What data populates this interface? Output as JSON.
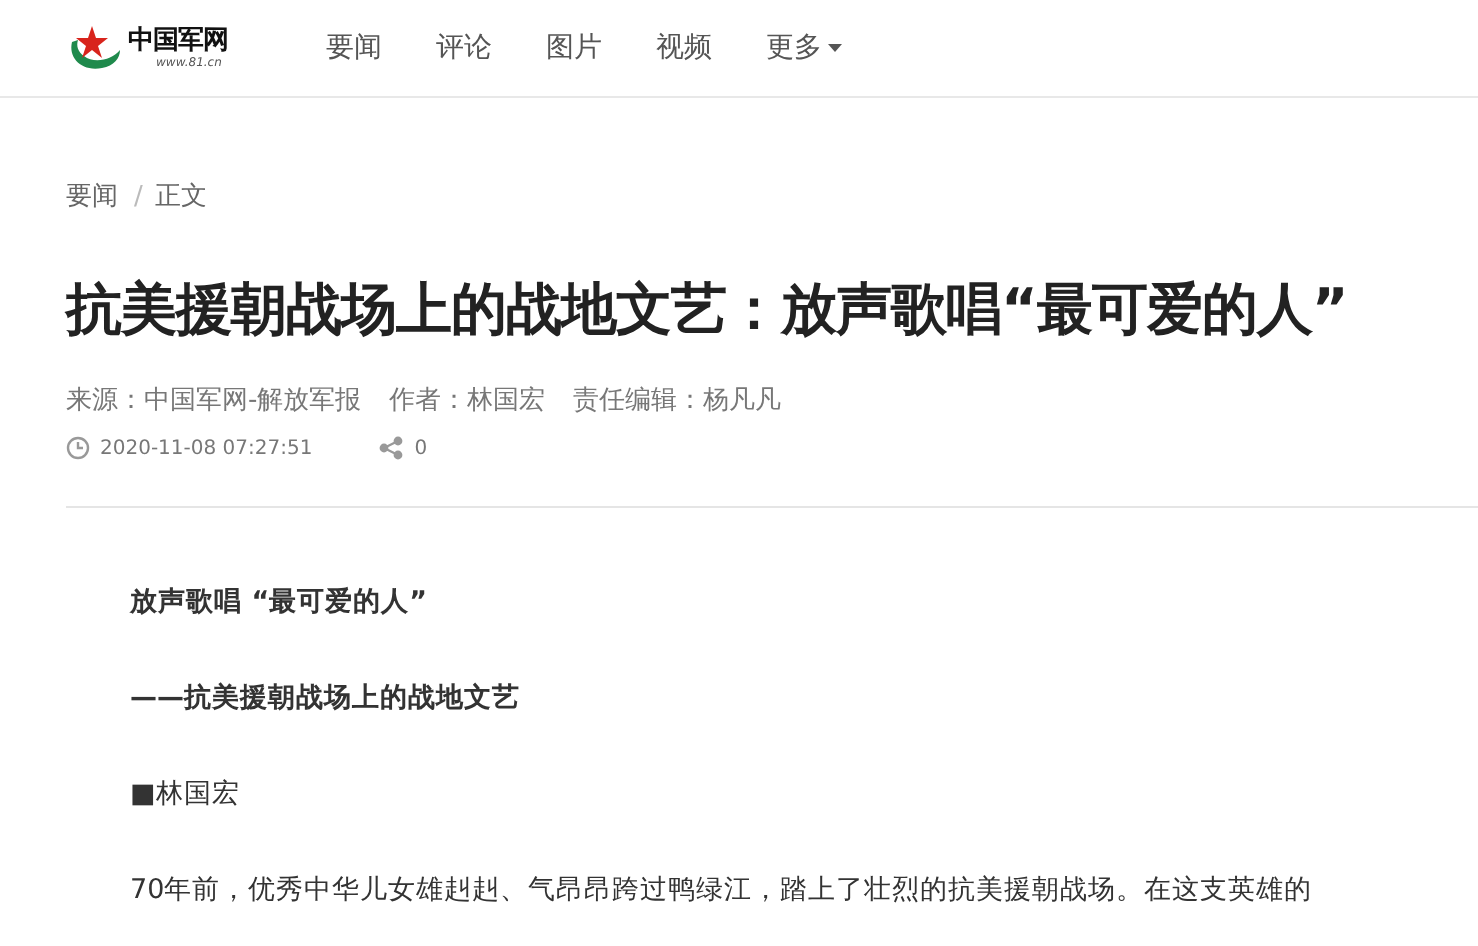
{
  "header": {
    "logo": {
      "name": "中国军网",
      "url": "www.81.cn"
    },
    "nav": [
      {
        "label": "要闻",
        "dropdown": false
      },
      {
        "label": "评论",
        "dropdown": false
      },
      {
        "label": "图片",
        "dropdown": false
      },
      {
        "label": "视频",
        "dropdown": false
      },
      {
        "label": "更多",
        "dropdown": true
      }
    ]
  },
  "breadcrumb": {
    "separator": "/",
    "items": [
      "要闻",
      "正文"
    ]
  },
  "article": {
    "title": "抗美援朝战场上的战地文艺：放声歌唱“最可爱的人”",
    "meta": [
      "来源：中国军网-解放军报",
      "作者：林国宏",
      "责任编辑：杨凡凡"
    ],
    "date": "2020-11-08 07:27:51",
    "shares": "0",
    "paragraphs": [
      {
        "kind": "heading",
        "text": "放声歌唱 “最可爱的人”"
      },
      {
        "kind": "subheading",
        "text": "——抗美援朝战场上的战地文艺"
      },
      {
        "kind": "byline",
        "text": "■林国宏"
      },
      {
        "kind": "body",
        "text": "70年前，优秀中华儿女雄赳赳、气昂昂跨过鸭绿江，踏上了壮烈的抗美援朝战场。在这支英雄的"
      }
    ]
  }
}
